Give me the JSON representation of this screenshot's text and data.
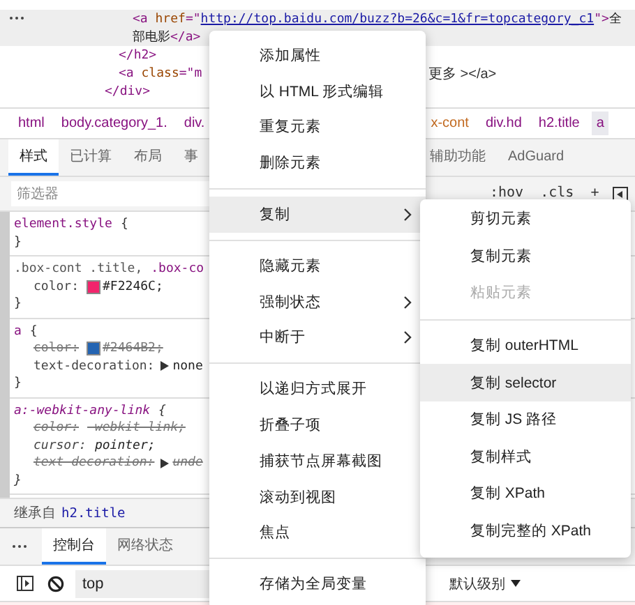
{
  "elements_tree": [
    {
      "children": [
        {
          "children": [
            {
              "lines": [
                [
                  {
                    "kind": "tag",
                    "text": "<a "
                  },
                  {
                    "kind": "attr",
                    "text": "href"
                  },
                  {
                    "kind": "tag",
                    "text": "=\""
                  },
                  {
                    "kind": "link",
                    "text": "http://top.baidu.com/buzz?b=26&c=1&fr=topcategory_c1"
                  },
                  {
                    "kind": "tag",
                    "text": "\">"
                  },
                  {
                    "kind": "text",
                    "text": "全"
                  }
                ],
                [
                  {
                    "kind": "text",
                    "text": "部电影"
                  },
                  {
                    "kind": "tag",
                    "text": "</a>"
                  }
                ]
              ],
              "selected": true
            }
          ],
          "close": [
            {
              "kind": "tag",
              "text": "</h2>"
            }
          ]
        },
        {
          "lines": [
            [
              {
                "kind": "tag",
                "text": "<a "
              },
              {
                "kind": "attr",
                "text": "class"
              },
              {
                "kind": "tag",
                "text": "=\"m"
              }
            ]
          ],
          "trailing": "更多 ></a>",
          "selected": false
        }
      ],
      "close": [
        {
          "kind": "tag",
          "text": "</div>"
        }
      ]
    }
  ],
  "breadcrumbs": [
    {
      "label": "html",
      "selected": false,
      "kind": "tag"
    },
    {
      "label": "body.category_1.",
      "selected": false,
      "kind": "tag"
    },
    {
      "label": "div.",
      "selected": false,
      "kind": "tag"
    },
    {
      "label": "x-cont",
      "selected": false,
      "kind": "class"
    },
    {
      "label": "div.hd",
      "selected": false,
      "kind": "tag"
    },
    {
      "label": "h2.title",
      "selected": false,
      "kind": "tag"
    },
    {
      "label": "a",
      "selected": true,
      "kind": "tag"
    }
  ],
  "tabs": [
    {
      "label": "样式",
      "selected": true
    },
    {
      "label": "已计算",
      "selected": false
    },
    {
      "label": "布局",
      "selected": false
    },
    {
      "label": "事",
      "selected": false
    },
    {
      "label": "辅助功能",
      "selected": false
    },
    {
      "label": "AdGuard",
      "selected": false
    }
  ],
  "filter": {
    "placeholder": "筛选器",
    "hov": ":hov",
    "cls": ".cls",
    "add": "+"
  },
  "rules": [
    {
      "selector": [
        {
          "text": "element.style",
          "matched": true
        }
      ],
      "kind": "author",
      "open": "{",
      "close": "}"
    },
    {
      "selector": [
        {
          "text": ".box-cont .title,",
          "matched": false
        },
        {
          "text": ".box-co",
          "matched": true
        }
      ],
      "kind": "author",
      "close": "}",
      "declarations": [
        {
          "property": "color:",
          "value": "#F2246C;",
          "color": "#f2246c",
          "overridden": false,
          "expandable": false
        }
      ]
    },
    {
      "selector": [
        {
          "text": "a",
          "matched": true
        }
      ],
      "kind": "author",
      "open": "{",
      "close": "}",
      "declarations": [
        {
          "property": "color:",
          "value": "#2464B2;",
          "color": "#2464b2",
          "overridden": true,
          "expandable": false
        },
        {
          "property": "text-decoration:",
          "value": "none",
          "overridden": false,
          "expandable": true
        }
      ]
    },
    {
      "selector": [
        {
          "text": "a:-webkit-any-link",
          "matched": true
        }
      ],
      "kind": "user-agent",
      "open": "{",
      "close": "}",
      "declarations": [
        {
          "property": "color:",
          "value": "-webkit-link;",
          "overridden": true,
          "expandable": false
        },
        {
          "property": "cursor:",
          "value": "pointer;",
          "overridden": false,
          "expandable": false
        },
        {
          "property": "text-decoration:",
          "value": "unde",
          "overridden": true,
          "expandable": true
        }
      ]
    }
  ],
  "inherited": {
    "label": "继承自",
    "selector": "h2.title"
  },
  "drawer_tabs": [
    {
      "label": "控制台",
      "selected": true
    },
    {
      "label": "网络状态",
      "selected": false
    }
  ],
  "console_toolbar": {
    "context": "top",
    "level": "默认级别"
  },
  "context_menu": {
    "items": [
      {
        "kind": "item",
        "label": "添加属性",
        "highlighted": false,
        "has_submenu": false
      },
      {
        "kind": "item",
        "label": "以 HTML 形式编辑",
        "highlighted": false,
        "has_submenu": false
      },
      {
        "kind": "item",
        "label": "重复元素",
        "highlighted": false,
        "has_submenu": false
      },
      {
        "kind": "item",
        "label": "删除元素",
        "highlighted": false,
        "has_submenu": false
      },
      {
        "kind": "separator"
      },
      {
        "kind": "item",
        "label": "复制",
        "highlighted": true,
        "has_submenu": true
      },
      {
        "kind": "separator"
      },
      {
        "kind": "item",
        "label": "隐藏元素",
        "highlighted": false,
        "has_submenu": false
      },
      {
        "kind": "item",
        "label": "强制状态",
        "highlighted": false,
        "has_submenu": true
      },
      {
        "kind": "item",
        "label": "中断于",
        "highlighted": false,
        "has_submenu": true
      },
      {
        "kind": "separator"
      },
      {
        "kind": "item",
        "label": "以递归方式展开",
        "highlighted": false,
        "has_submenu": false
      },
      {
        "kind": "item",
        "label": "折叠子项",
        "highlighted": false,
        "has_submenu": false
      },
      {
        "kind": "item",
        "label": "捕获节点屏幕截图",
        "highlighted": false,
        "has_submenu": false
      },
      {
        "kind": "item",
        "label": "滚动到视图",
        "highlighted": false,
        "has_submenu": false
      },
      {
        "kind": "item",
        "label": "焦点",
        "highlighted": false,
        "has_submenu": false
      },
      {
        "kind": "separator"
      },
      {
        "kind": "item",
        "label": "存储为全局变量",
        "highlighted": false,
        "has_submenu": false
      }
    ]
  },
  "copy_submenu": {
    "items": [
      {
        "kind": "item",
        "label": "剪切元素",
        "highlighted": false,
        "disabled": false
      },
      {
        "kind": "item",
        "label": "复制元素",
        "highlighted": false,
        "disabled": false
      },
      {
        "kind": "item",
        "label": "粘贴元素",
        "highlighted": false,
        "disabled": true
      },
      {
        "kind": "separator"
      },
      {
        "kind": "item",
        "label": "复制 outerHTML",
        "highlighted": false,
        "disabled": false
      },
      {
        "kind": "item",
        "label": "复制 selector",
        "highlighted": true,
        "disabled": false
      },
      {
        "kind": "item",
        "label": "复制 JS 路径",
        "highlighted": false,
        "disabled": false
      },
      {
        "kind": "item",
        "label": "复制样式",
        "highlighted": false,
        "disabled": false
      },
      {
        "kind": "item",
        "label": "复制 XPath",
        "highlighted": false,
        "disabled": false
      },
      {
        "kind": "item",
        "label": "复制完整的 XPath",
        "highlighted": false,
        "disabled": false
      }
    ]
  }
}
